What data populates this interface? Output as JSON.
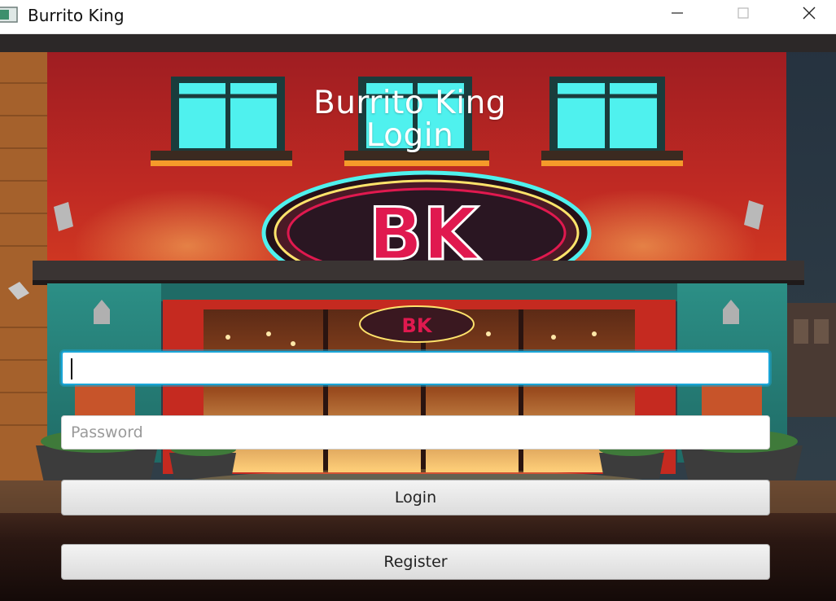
{
  "window": {
    "title": "Burrito King",
    "app_icon": "app-window-icon",
    "controls": [
      "minimize-icon",
      "maximize-icon",
      "close-icon"
    ]
  },
  "header": {
    "line1": "Burrito King",
    "line2": "Login"
  },
  "background": {
    "description_icon": "storefront-illustration",
    "sign_text": "BK"
  },
  "form": {
    "username": {
      "value": "",
      "placeholder": ""
    },
    "password": {
      "value": "",
      "placeholder": "Password"
    },
    "login_label": "Login",
    "register_label": "Register"
  },
  "colors": {
    "focus_ring": "#1aa6d8",
    "facade_red": "#b81f1d",
    "window_cyan": "#4ff1ee",
    "sign_pink": "#e0194f"
  }
}
